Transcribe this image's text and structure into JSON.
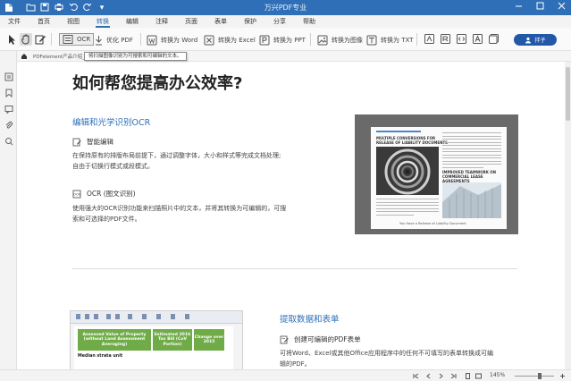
{
  "window": {
    "title": "万兴PDF专业"
  },
  "menu": {
    "items": [
      "文件",
      "首页",
      "视图",
      "转换",
      "编辑",
      "注释",
      "页面",
      "表单",
      "保护",
      "分享",
      "帮助"
    ],
    "active_index": 3
  },
  "toolbar": {
    "ocr": "OCR",
    "optimize": "优化 PDF",
    "to_word": "转换为 Word",
    "to_excel": "转换为 Excel",
    "to_ppt": "转换为 PPT",
    "to_image": "转换为图像",
    "to_txt": "转换为 TXT",
    "share": "拌子"
  },
  "tooltip": {
    "text": "将扫描图像识别为可搜索和可编辑的文本。"
  },
  "tab": {
    "name": "PDFelement产品介绍_o"
  },
  "doc": {
    "heading": "如何帮您提高办公效率?",
    "section1": {
      "title": "编辑和光学识别OCR",
      "sub1": "智能编辑",
      "para1_l1": "在保持原有的排版布局前提下，通过调整字体，大小和样式等完成文档处理;",
      "para1_l2": "自由于切换行模式或段模式。",
      "sub2": "OCR (图文识别)",
      "para2_l1": "使用强大的OCR识别功能来扫描照片中的文本，并将其转换为可编辑的，可搜",
      "para2_l2": "索和可选择的PDF文件。"
    },
    "magazine": {
      "headline_l1": "MULTIPLE    CONVERSIONS    FOR",
      "headline_l2": "RELEASE OF LIABILITY DOCUMENTS",
      "sub_l1": "IMPROVED TEAMWORK ON",
      "sub_l2": "COMMERCIAL LEASE AGREEMENTS",
      "caption": "You Have a Release of Liability Document"
    },
    "table_image": {
      "col1": "Assessed Value of Property (without Land Assessment Averaging)",
      "col2": "Estimated 2016 Tax Bill (CoV Portion)",
      "col3": "Change over 2015",
      "row1": "Median strata unit"
    },
    "section2": {
      "title": "提取数据和表单",
      "sub1": "创建可编辑的PDF表单",
      "para1_l1": "可将Word、Excel或其他Office应用程序中的任何不可填写的表单转换成可编",
      "para1_l2": "辑的PDF。"
    }
  },
  "status": {
    "zoom": "145%"
  },
  "colors": {
    "title_bar": "#2f6fb7",
    "accent": "#2f6fb7",
    "share_button": "#2358a8",
    "table_header": "#6fab47"
  }
}
